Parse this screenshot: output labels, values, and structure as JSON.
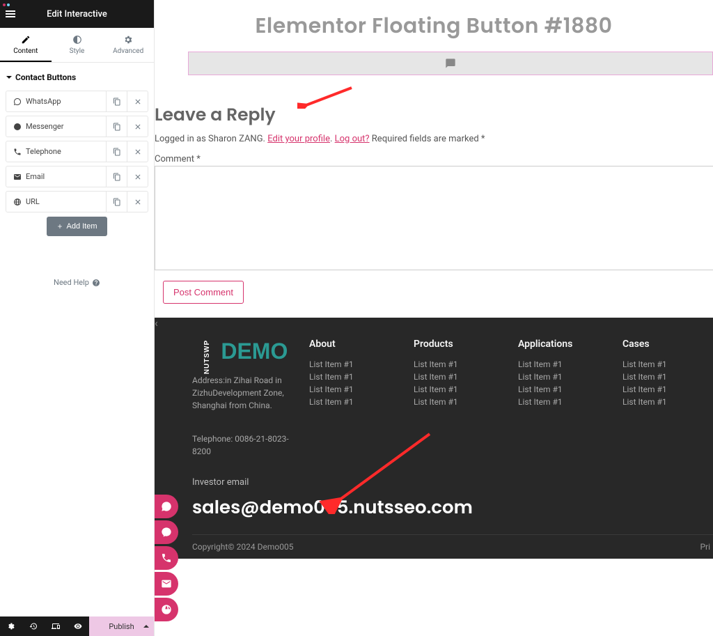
{
  "header": {
    "title": "Edit Interactive"
  },
  "tabs": [
    {
      "label": "Content",
      "active": true
    },
    {
      "label": "Style",
      "active": false
    },
    {
      "label": "Advanced",
      "active": false
    }
  ],
  "section": {
    "title": "Contact Buttons"
  },
  "items": [
    {
      "label": "WhatsApp",
      "icon": "whatsapp-icon"
    },
    {
      "label": "Messenger",
      "icon": "messenger-icon"
    },
    {
      "label": "Telephone",
      "icon": "phone-icon"
    },
    {
      "label": "Email",
      "icon": "email-icon"
    },
    {
      "label": "URL",
      "icon": "globe-icon"
    }
  ],
  "add_item": "Add Item",
  "need_help": "Need Help",
  "bottombar": {
    "publish": "Publish"
  },
  "preview": {
    "page_title": "Elementor Floating Button #1880",
    "reply": {
      "heading": "Leave a Reply",
      "logged_in_pre": "Logged in as Sharon ZANG. ",
      "edit_profile": "Edit your profile",
      "sep": ". ",
      "logout": "Log out?",
      "required": " Required fields are marked *",
      "comment_label": "Comment *",
      "post_button": "Post Comment"
    }
  },
  "footer": {
    "address": "Address:in Zihai Road in ZizhuDevelopment Zone, Shanghai from China.",
    "telephone": "Telephone: 0086-21-8023-8200",
    "cols": [
      {
        "title": "About",
        "items": [
          "List Item #1",
          "List Item #1",
          "List Item #1",
          "List Item #1"
        ]
      },
      {
        "title": "Products",
        "items": [
          "List Item #1",
          "List Item #1",
          "List Item #1",
          "List Item #1"
        ]
      },
      {
        "title": "Applications",
        "items": [
          "List Item #1",
          "List Item #1",
          "List Item #1",
          "List Item #1"
        ]
      },
      {
        "title": "Cases",
        "items": [
          "List Item #1",
          "List Item #1",
          "List Item #1",
          "List Item #1"
        ]
      }
    ],
    "investor_label": "Investor email",
    "email": "sales@demo005.nutsseo.com",
    "copyright": "Copyright© 2024 Demo005",
    "privacy": "Pri"
  },
  "floating_buttons": [
    "whatsapp",
    "messenger",
    "phone",
    "email",
    "globe"
  ]
}
